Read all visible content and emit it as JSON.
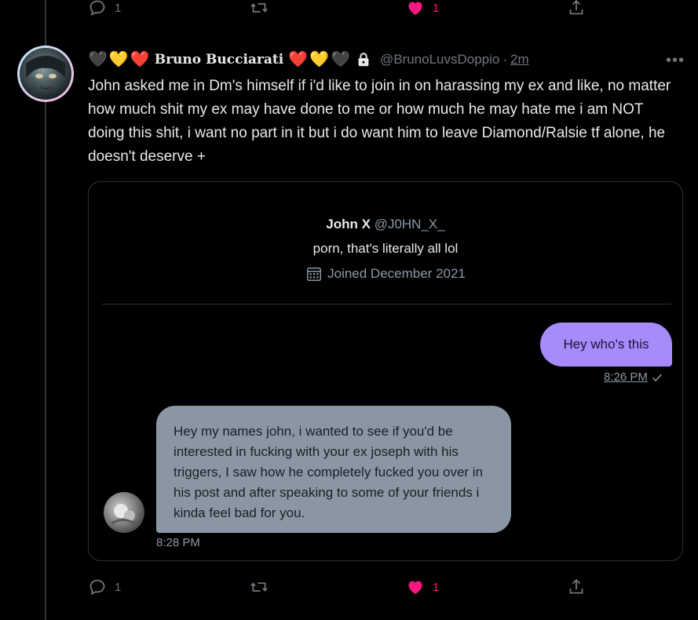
{
  "top_actions": {
    "reply_count": "1",
    "like_count": "1"
  },
  "tweet": {
    "hearts_left": [
      "🖤",
      "💛",
      "❤️"
    ],
    "display_name": "Bruno Bucciarati",
    "hearts_right": [
      "❤️",
      "💛",
      "🖤"
    ],
    "handle": "@BrunoLuvsDoppio",
    "separator": "·",
    "time": "2m",
    "more": "•••",
    "text": "John asked me in Dm's himself if i'd like to join in on harassing my ex and like, no matter how much shit my ex may have done to me or how much he may hate me i am NOT doing this shit, i want no part in it but i do want him to leave Diamond/Ralsie tf alone, he doesn't deserve +"
  },
  "card": {
    "profile": {
      "name": "John X",
      "handle": "@J0HN_X_",
      "bio": "porn, that's literally all lol",
      "joined": "Joined December 2021"
    },
    "messages": [
      {
        "direction": "sent",
        "text": "Hey who's this",
        "time": "8:26 PM"
      },
      {
        "direction": "received",
        "text": "Hey my names john, i wanted to see if you'd be interested in fucking with your ex joseph with his triggers, I saw how he completely fucked you over in his post and after speaking to some of your friends i kinda feel bad for you.",
        "time": "8:28 PM"
      }
    ]
  },
  "bottom_actions": {
    "reply_count": "1",
    "like_count": "1"
  },
  "colors": {
    "background": "#000000",
    "text": "#e7e9ea",
    "secondary": "#71767b",
    "like": "#f91880",
    "sent_bubble": "#a78bfa",
    "received_bubble": "#8a96a3"
  },
  "icons": [
    "reply-icon",
    "retweet-icon",
    "like-icon",
    "share-icon",
    "lock-icon",
    "calendar-icon",
    "checkmark-icon",
    "more-icon"
  ]
}
